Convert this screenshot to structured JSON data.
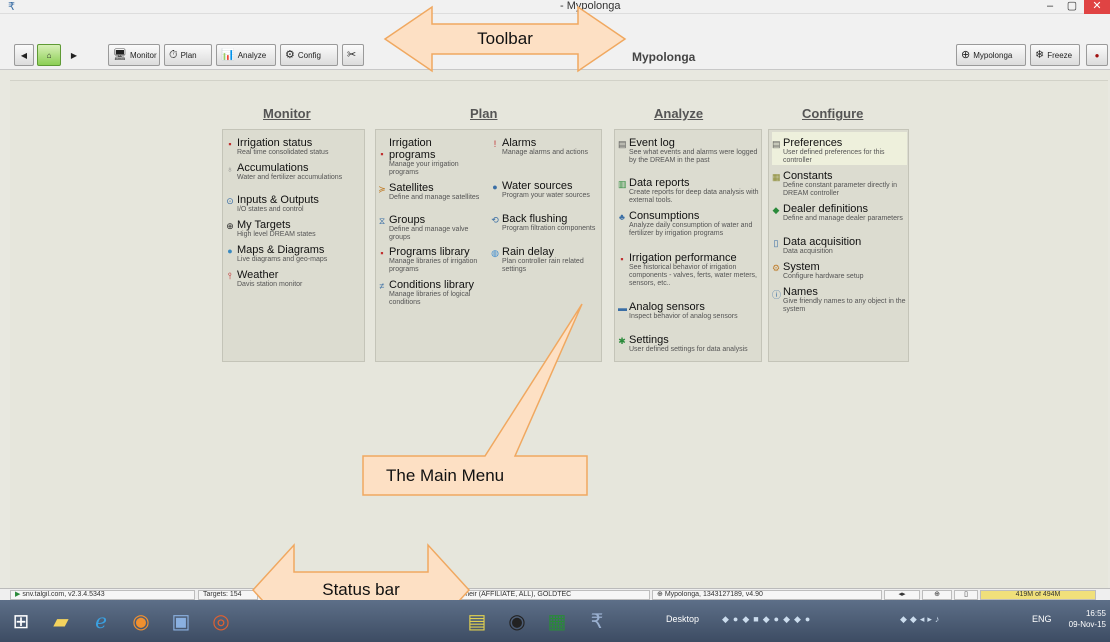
{
  "window": {
    "title": "- Mypolonga",
    "minimize": "–",
    "maximize": "▢",
    "close": "✕"
  },
  "toolbar": {
    "back": "◀",
    "home": "⌂",
    "forward": "▶",
    "monitor": "Monitor",
    "plan": "Plan",
    "analyze": "Analyze",
    "config": "Config",
    "title": "Mypolonga",
    "site_button": "Mypolonga",
    "freeze": "Freeze",
    "record": "●"
  },
  "callouts": {
    "toolbar": "Toolbar",
    "main_menu": "The Main Menu",
    "status_bar": "Status bar"
  },
  "columns": {
    "monitor": "Monitor",
    "plan": "Plan",
    "analyze": "Analyze",
    "configure": "Configure"
  },
  "monitor_items": [
    {
      "title": "Irrigation status",
      "desc": "Real time consolidated status"
    },
    {
      "title": "Accumulations",
      "desc": "Water and fertilizer accumulations"
    },
    {
      "title": "Inputs & Outputs",
      "desc": "I/O states and control"
    },
    {
      "title": "My Targets",
      "desc": "High level DREAM states"
    },
    {
      "title": "Maps & Diagrams",
      "desc": "Live diagrams and geo-maps"
    },
    {
      "title": "Weather",
      "desc": "Davis station monitor"
    }
  ],
  "plan_left": [
    {
      "title": "Irrigation programs",
      "desc": "Manage your irrigation programs"
    },
    {
      "title": "Satellites",
      "desc": "Define and manage satellites"
    },
    {
      "title": "Groups",
      "desc": "Define and manage valve groups"
    },
    {
      "title": "Programs library",
      "desc": "Manage libraries of irrigation programs"
    },
    {
      "title": "Conditions library",
      "desc": "Manage libraries of logical conditions"
    }
  ],
  "plan_right": [
    {
      "title": "Alarms",
      "desc": "Manage alarms and actions"
    },
    {
      "title": "Water sources",
      "desc": "Program your water sources"
    },
    {
      "title": "Back flushing",
      "desc": "Program filtration components"
    },
    {
      "title": "Rain delay",
      "desc": "Plan controller rain related settings"
    }
  ],
  "analyze_items": [
    {
      "title": "Event log",
      "desc": "See what events and alarms were logged by the DREAM in the past"
    },
    {
      "title": "Data reports",
      "desc": "Create reports for deep data analysis with external tools."
    },
    {
      "title": "Consumptions",
      "desc": "Analyze daily consumption of water and fertilizer by irrigation programs"
    },
    {
      "title": "Irrigation performance",
      "desc": "See historical behavior of irrigation components - valves, ferts, water meters, sensors, etc.."
    },
    {
      "title": "Analog sensors",
      "desc": "Inspect behavior of analog sensors"
    },
    {
      "title": "Settings",
      "desc": "User defined settings for data analysis"
    }
  ],
  "configure_items": [
    {
      "title": "Preferences",
      "desc": "User defined preferences for this controller"
    },
    {
      "title": "Constants",
      "desc": "Define constant parameter directly in DREAM controller"
    },
    {
      "title": "Dealer definitions",
      "desc": "Define and manage dealer parameters"
    },
    {
      "title": "Data acquisition",
      "desc": "Data acquisition"
    },
    {
      "title": "System",
      "desc": "Configure hardware setup"
    },
    {
      "title": "Names",
      "desc": "Give friendly names to any object in the system"
    }
  ],
  "status": {
    "server": "snv.talgil.com, v2.3.4.5343",
    "targets": "Targets: 154",
    "user": "meir (AFFILIATE, ALL), GOLDTEC",
    "controller": "Mypolonga, 1343127189, v4.90",
    "memory": "419M of 494M"
  },
  "taskbar": {
    "desktop": "Desktop",
    "lang": "ENG",
    "time": "16:55",
    "date": "09-Nov-15"
  },
  "colors": {
    "accent_green": "#8ccf55",
    "callout_fill": "#fde0c4",
    "memory": "#f0e07a"
  }
}
